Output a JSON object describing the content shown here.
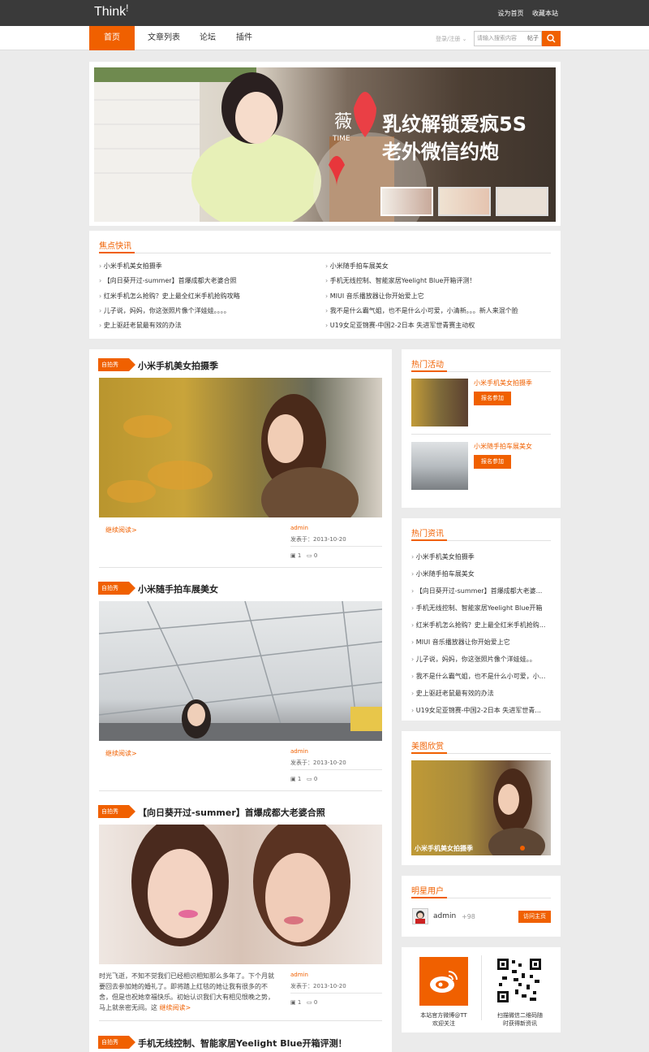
{
  "header": {
    "logo": "Think",
    "logo_mark": "!",
    "links": [
      "设为首页",
      "收藏本站"
    ]
  },
  "nav": {
    "items": [
      "首页",
      "文章列表",
      "论坛",
      "插件"
    ],
    "login": "登录/注册",
    "search_placeholder": "请输入搜索内容",
    "search_scope": "帖子"
  },
  "banner": {
    "headline1": "乳纹解锁爱疯5S",
    "headline2": "老外微信约炮",
    "badge_char": "薇",
    "badge_sub": "TIME"
  },
  "quick_news": {
    "title": "焦点快讯",
    "left": [
      "小米手机美女拍摄季",
      "【向日葵开过-summer】首爆成都大老婆合照",
      "红米手机怎么抢购？史上最全红米手机抢购攻略",
      "儿子说，妈妈，你这张照片像个洋娃娃。。。。",
      "史上驱赶老鼠最有效的办法"
    ],
    "right": [
      "小米随手拍车展美女",
      "手机无线控制、智能家居Yeelight Blue开箱评测！",
      "MIUI 音乐播放器让你开始爱上它",
      "我不是什么霸气姐，也不是什么小可爱，小清新。。。新人来混个脸",
      "U19女足亚锦赛-中国2-2日本 失进军世青赛主动权"
    ]
  },
  "articles": [
    {
      "tag": "自拍秀",
      "title": "小米手机美女拍摄季",
      "more": "继续阅读>",
      "author": "admin",
      "date": "发表于：2013-10-20",
      "likes": "1",
      "comments": "0"
    },
    {
      "tag": "自拍秀",
      "title": "小米随手拍车展美女",
      "more": "继续阅读>",
      "author": "admin",
      "date": "发表于：2013-10-20",
      "likes": "1",
      "comments": "0"
    },
    {
      "tag": "自拍秀",
      "title": "【向日葵开过-summer】首爆成都大老婆合照",
      "excerpt": "时光飞逝，不知不觉我们已经相识相知那么多年了。下个月就要回去参加她的婚礼了。即将踏上红毯的她让我有很多的不舍，但是也祝她幸福快乐。初始认识我们大有相见恨晚之势，马上就亲密无间。这",
      "more": "继续阅读>",
      "author": "admin",
      "date": "发表于：2013-10-20",
      "likes": "1",
      "comments": "0"
    },
    {
      "tag": "自拍秀",
      "title": "手机无线控制、智能家居Yeelight Blue开箱评测！"
    }
  ],
  "hot_events": {
    "title": "热门活动",
    "items": [
      {
        "title": "小米手机美女拍摄季",
        "button": "报名参加"
      },
      {
        "title": "小米随手拍车展美女",
        "button": "报名参加"
      }
    ]
  },
  "hot_news": {
    "title": "热门资讯",
    "items": [
      "小米手机美女拍摄季",
      "小米随手拍车展美女",
      "【向日葵开过-summer】首爆成都大老婆...",
      "手机无线控制、智能家居Yeelight Blue开箱",
      "红米手机怎么抢购？史上最全红米手机抢购...",
      "MIUI 音乐播放器让你开始爱上它",
      "儿子说，妈妈，你这张照片像个洋娃娃。。",
      "我不是什么霸气姐，也不是什么小可爱，小...",
      "史上驱赶老鼠最有效的办法",
      "U19女足亚锦赛-中国2-2日本 失进军世青..."
    ]
  },
  "gallery": {
    "title": "美图欣赏",
    "caption": "小米手机美女拍摄季"
  },
  "star_user": {
    "title": "明星用户",
    "name": "admin",
    "score": "+98",
    "button": "访问主页"
  },
  "follow": {
    "weibo": "本站官方微博@TT",
    "weibo2": "欢迎关注",
    "wechat": "扫描微信二维码随",
    "wechat2": "时获得新资讯"
  },
  "colors": {
    "accent": "#f06000",
    "topbar": "#3a3a3a"
  }
}
